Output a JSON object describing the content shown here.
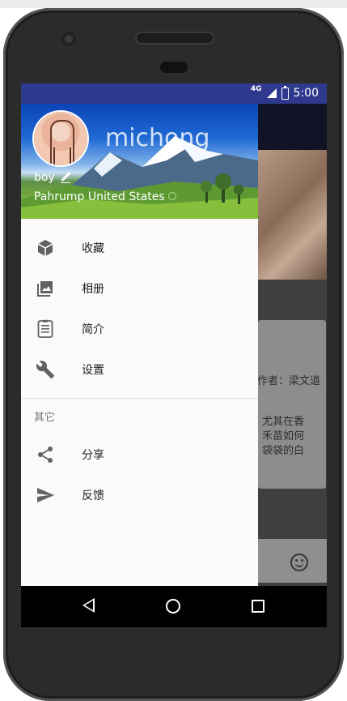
{
  "status_bar": {
    "network": "4G",
    "time": "5:00"
  },
  "drawer_header": {
    "username": "michong",
    "gender": "boy",
    "location": "Pahrump  United States"
  },
  "menu": {
    "primary": [
      {
        "label": "收藏",
        "icon": "cube-icon"
      },
      {
        "label": "相册",
        "icon": "photo-album-icon"
      },
      {
        "label": "简介",
        "icon": "clipboard-icon"
      },
      {
        "label": "设置",
        "icon": "wrench-icon"
      }
    ],
    "section_title": "其它",
    "secondary": [
      {
        "label": "分享",
        "icon": "share-icon"
      },
      {
        "label": "反馈",
        "icon": "send-icon"
      }
    ]
  },
  "background_content": {
    "line1": "作者：梁文道",
    "line2": "尤其在香",
    "line3": "禾苗如何",
    "line4": "袋袋的白"
  },
  "colors": {
    "status_bar": "#2f3a8f",
    "drawer_bg": "#fafafa",
    "scrim": "#3f3f3f",
    "icon": "#616161"
  }
}
